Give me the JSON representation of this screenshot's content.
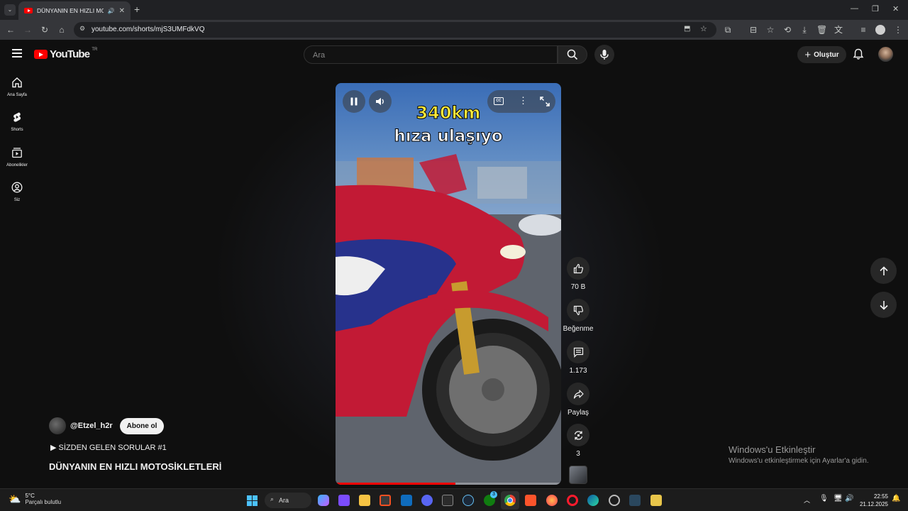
{
  "browser": {
    "tab_title": "DÜNYANIN EN HIZLI MOTOSİ",
    "url": "youtube.com/shorts/mjS3UMFdkVQ"
  },
  "header": {
    "logo_text": "YouTube",
    "country": "TR",
    "search_placeholder": "Ara",
    "create_label": "Oluştur"
  },
  "sidebar": {
    "items": [
      {
        "label": "Ana Sayfa",
        "icon": "home-icon"
      },
      {
        "label": "Shorts",
        "icon": "shorts-icon"
      },
      {
        "label": "Abonelikler",
        "icon": "subscriptions-icon"
      },
      {
        "label": "Siz",
        "icon": "you-icon"
      }
    ]
  },
  "video": {
    "overlay_line1": "340km",
    "overlay_line2": "hıza ulaşıyo",
    "progress": 0.53
  },
  "actions": {
    "likes": "70 B",
    "dislike_label": "Beğenme",
    "comments": "1.173",
    "share_label": "Paylaş",
    "remix_count": "3"
  },
  "channel": {
    "name": "@Etzel_h2r",
    "subscribe_label": "Abone ol",
    "playlist": "▶ SİZDEN GELEN SORULAR #1",
    "title": "DÜNYANIN EN HIZLI MOTOSİKLETLERİ"
  },
  "windows": {
    "activate_title": "Windows'u Etkinleştir",
    "activate_sub": "Windows'u etkinleştirmek için Ayarlar'a gidin."
  },
  "taskbar": {
    "weather_temp": "5°C",
    "weather_desc": "Parçalı bulutlu",
    "search_label": "Ara",
    "time": "22:55",
    "date": "21.12.2025",
    "xbox_badge": "3"
  }
}
